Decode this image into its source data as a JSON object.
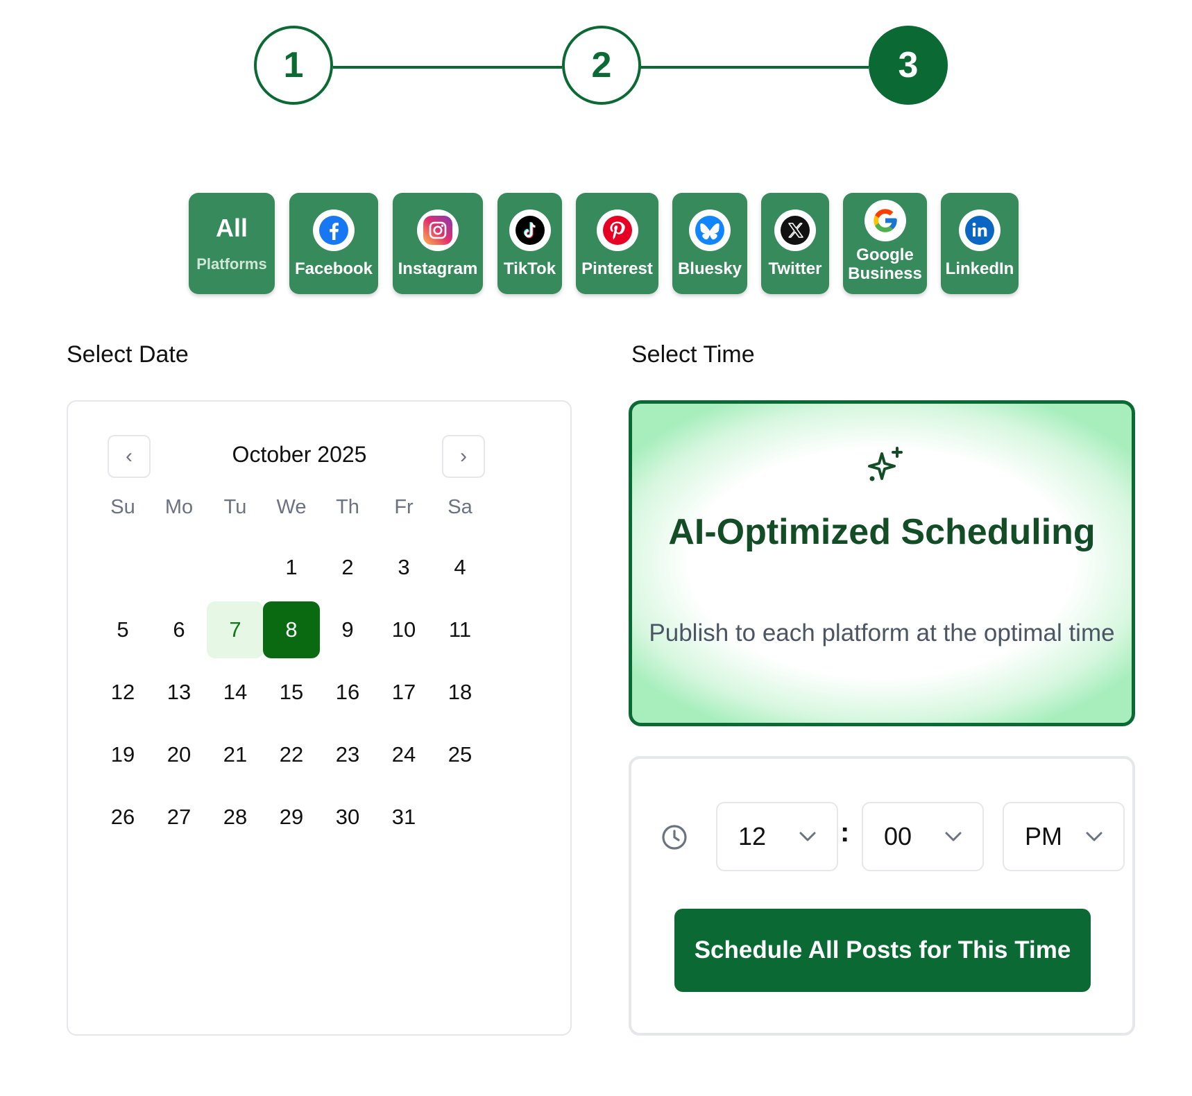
{
  "stepper": {
    "steps": [
      "1",
      "2",
      "3"
    ],
    "active_step": 3,
    "accent_color": "#0b6a34"
  },
  "platforms": {
    "all": {
      "top": "All",
      "bottom": "Platforms"
    },
    "items": [
      {
        "label": "Facebook",
        "icon": "facebook-icon"
      },
      {
        "label": "Instagram",
        "icon": "instagram-icon"
      },
      {
        "label": "TikTok",
        "icon": "tiktok-icon"
      },
      {
        "label": "Pinterest",
        "icon": "pinterest-icon"
      },
      {
        "label": "Bluesky",
        "icon": "bluesky-icon"
      },
      {
        "label": "Twitter",
        "icon": "x-icon"
      },
      {
        "label": "Google Business",
        "icon": "google-icon"
      },
      {
        "label": "LinkedIn",
        "icon": "linkedin-icon"
      }
    ]
  },
  "date_section": {
    "title": "Select Date"
  },
  "time_section": {
    "title": "Select Time"
  },
  "calendar": {
    "month_label": "October 2025",
    "prev_label": "‹",
    "next_label": "›",
    "weekdays": [
      "Su",
      "Mo",
      "Tu",
      "We",
      "Th",
      "Fr",
      "Sa"
    ],
    "first_weekday_index": 3,
    "days_in_month": 31,
    "today": 7,
    "selected": 8
  },
  "ai_card": {
    "title": "AI-Optimized Scheduling",
    "subtitle": "Publish to each platform at the optimal time",
    "icon": "sparkles-icon"
  },
  "time_picker": {
    "hour": "12",
    "minute": "00",
    "colon": ":",
    "period": "PM",
    "icon": "clock-icon"
  },
  "schedule_button": {
    "label": "Schedule All Posts for This Time"
  }
}
